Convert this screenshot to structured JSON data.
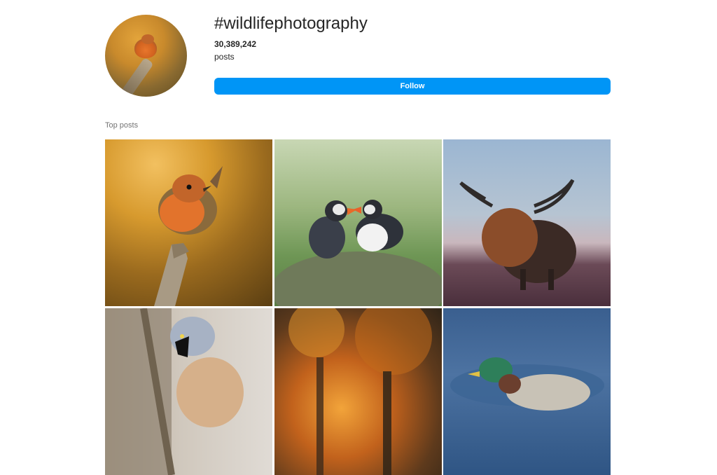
{
  "profile": {
    "hashtag": "#wildlifephotography",
    "post_count": "30,389,242",
    "posts_label": "posts",
    "follow_label": "Follow"
  },
  "section_title": "Top posts",
  "colors": {
    "follow_button": "#0095f6",
    "text_primary": "#262626",
    "text_secondary": "#737373"
  },
  "posts": [
    {
      "subject": "robin on branch"
    },
    {
      "subject": "two puffins on rock"
    },
    {
      "subject": "highland cow in heather"
    },
    {
      "subject": "bearded reedling on reed"
    },
    {
      "subject": "autumn forest"
    },
    {
      "subject": "mallard duck on water"
    }
  ]
}
